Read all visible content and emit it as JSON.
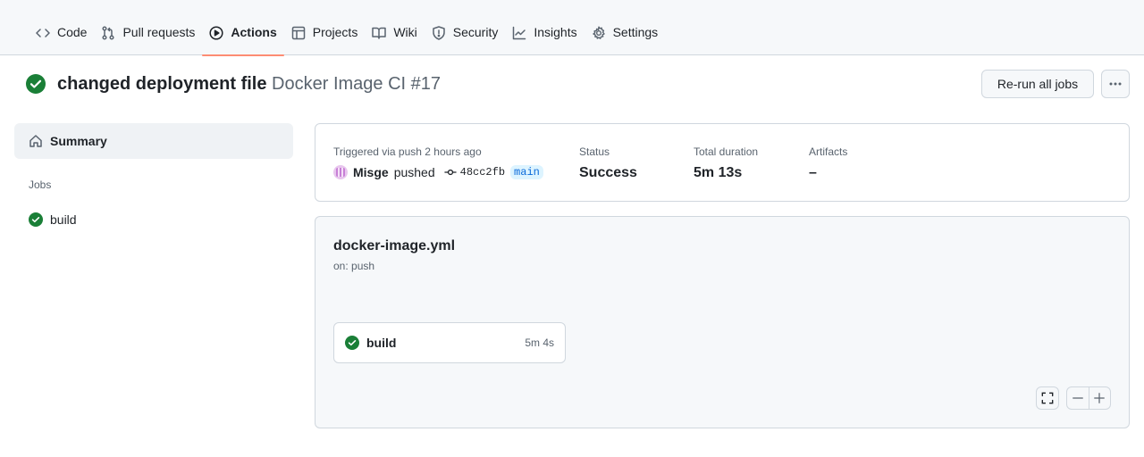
{
  "nav": {
    "tabs": [
      {
        "label": "Code",
        "icon": "code-icon"
      },
      {
        "label": "Pull requests",
        "icon": "git-pull-request-icon"
      },
      {
        "label": "Actions",
        "icon": "play-icon",
        "selected": true
      },
      {
        "label": "Projects",
        "icon": "table-icon"
      },
      {
        "label": "Wiki",
        "icon": "book-icon"
      },
      {
        "label": "Security",
        "icon": "shield-icon"
      },
      {
        "label": "Insights",
        "icon": "graph-icon"
      },
      {
        "label": "Settings",
        "icon": "gear-icon"
      }
    ]
  },
  "run": {
    "title": "changed deployment file",
    "workflow_label": "Docker Image CI #17",
    "status_icon": "check-circle-fill-icon",
    "rerun_label": "Re-run all jobs"
  },
  "sidebar": {
    "summary_label": "Summary",
    "jobs_heading": "Jobs",
    "jobs": [
      {
        "label": "build",
        "status": "success"
      }
    ]
  },
  "info": {
    "trigger_text": "Triggered via push 2 hours ago",
    "actor": "Misge",
    "action": "pushed",
    "commit": "48cc2fb",
    "branch": "main",
    "status_label": "Status",
    "status_value": "Success",
    "duration_label": "Total duration",
    "duration_value": "5m 13s",
    "artifacts_label": "Artifacts",
    "artifacts_value": "–"
  },
  "graph": {
    "workflow_file": "docker-image.yml",
    "trigger": "on: push",
    "jobs": [
      {
        "name": "build",
        "duration": "5m 4s",
        "status": "success"
      }
    ]
  },
  "colors": {
    "success": "#1a7f37",
    "tab_underline": "#fd8c73",
    "link": "#0969da"
  }
}
